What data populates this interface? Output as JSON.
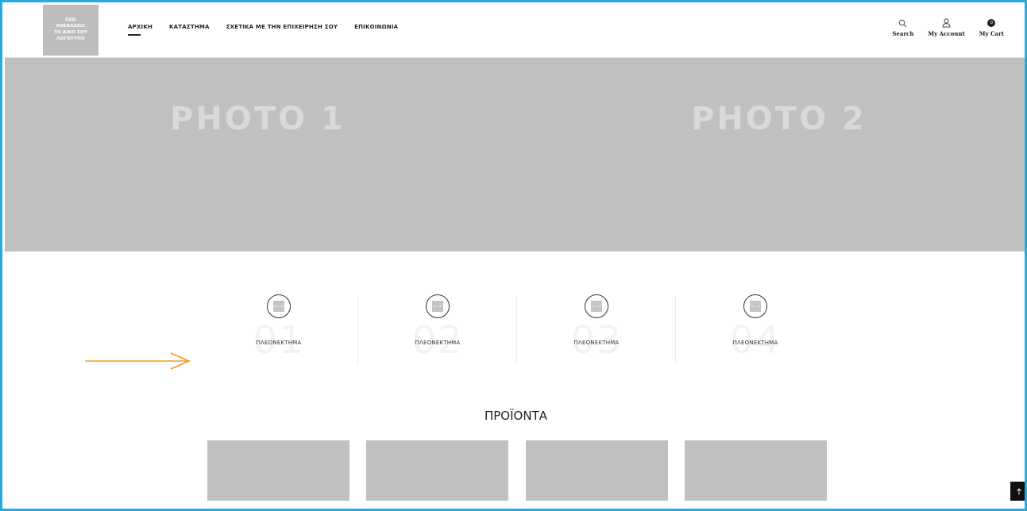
{
  "header": {
    "logo_text": "ΕΔΩ\nΑΝΕΒΑΖΕΙΣ\nΤΟ ΔΙΚΟ ΣΟΥ\nΛΟΓΟΤΥΠΟ",
    "nav": [
      {
        "label": "ΑΡΧΙΚΗ",
        "active": true
      },
      {
        "label": "ΚΑΤΑΣΤΗΜΑ",
        "active": false
      },
      {
        "label": "ΣΧΕΤΙΚΑ ΜΕ ΤΗΝ ΕΠΙΧΕΙΡΗΣΗ ΣΟΥ",
        "active": false
      },
      {
        "label": "ΕΠΙΚΟΙΝΩΝΙΑ",
        "active": false
      }
    ],
    "actions": {
      "search_label": "Search",
      "account_label": "My Account",
      "cart_label": "My Cart",
      "cart_count": "0"
    }
  },
  "hero": {
    "photo1": "PHOTO 1",
    "photo2": "PHOTO 2"
  },
  "advantages": [
    {
      "placeholder": "40 x 40",
      "number": "01",
      "title": "ΠΛΕΟΝΕΚΤΗΜΑ"
    },
    {
      "placeholder": "40 x 40",
      "number": "02",
      "title": "ΠΛΕΟΝΕΚΤΗΜΑ"
    },
    {
      "placeholder": "40 x 40",
      "number": "03",
      "title": "ΠΛΕΟΝΕΚΤΗΜΑ"
    },
    {
      "placeholder": "40 x 40",
      "number": "04",
      "title": "ΠΛΕΟΝΕΚΤΗΜΑ"
    }
  ],
  "products": {
    "title": "ΠΡΟΪΟΝΤΑ",
    "count": 4
  },
  "colors": {
    "frame": "#29a8df",
    "arrow": "#f39a1e",
    "placeholder_gray": "#bfc0c2"
  }
}
